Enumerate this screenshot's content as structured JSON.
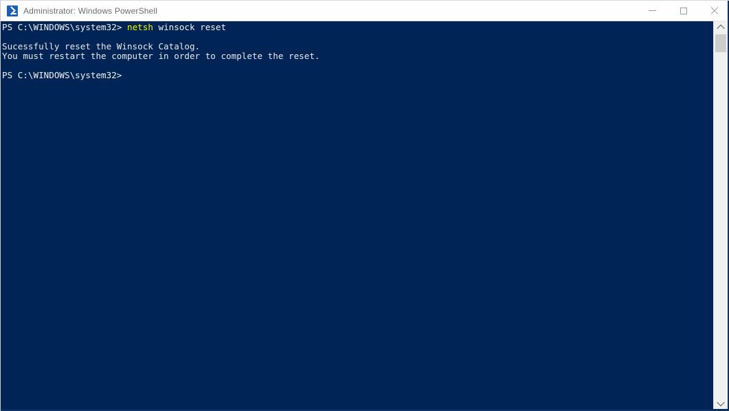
{
  "window": {
    "title": "Administrator: Windows PowerShell",
    "icon": "powershell-prompt-icon",
    "colors": {
      "titlebar_bg": "#ffffff",
      "titlebar_text": "#6b6b6b",
      "console_bg": "#012456",
      "console_text": "#e8e8e8",
      "command_token": "#f2f200",
      "scrollbar_track": "#f0f0f0",
      "scrollbar_thumb": "#cdcdcd",
      "window_border": "#0d3266"
    }
  },
  "titlebar_buttons": {
    "minimize_label": "—",
    "maximize_label": "□",
    "close_label": "✕"
  },
  "console": {
    "lines": [
      {
        "id": "line-prompt-1",
        "segments": [
          {
            "text": "PS C:\\WINDOWS\\system32> ",
            "style": "tok-white"
          },
          {
            "text": "netsh",
            "style": "tok-yellow"
          },
          {
            "text": " winsock reset",
            "style": "tok-white"
          }
        ]
      },
      {
        "id": "line-blank-1",
        "segments": [
          {
            "text": "",
            "style": "tok-out"
          }
        ]
      },
      {
        "id": "line-output-1",
        "segments": [
          {
            "text": "Sucessfully reset the Winsock Catalog.",
            "style": "tok-out"
          }
        ]
      },
      {
        "id": "line-output-2",
        "segments": [
          {
            "text": "You must restart the computer in order to complete the reset.",
            "style": "tok-out"
          }
        ]
      },
      {
        "id": "line-blank-2",
        "segments": [
          {
            "text": "",
            "style": "tok-out"
          }
        ]
      },
      {
        "id": "line-prompt-2",
        "segments": [
          {
            "text": "PS C:\\WINDOWS\\system32>",
            "style": "tok-white"
          }
        ]
      }
    ],
    "prompt_path": "PS C:\\WINDOWS\\system32>",
    "command": "netsh winsock reset"
  },
  "scrollbar": {
    "up_arrow": "chevron-up-icon",
    "down_arrow": "chevron-down-icon",
    "thumb_position_percent": 0,
    "thumb_size_percent": 5
  }
}
